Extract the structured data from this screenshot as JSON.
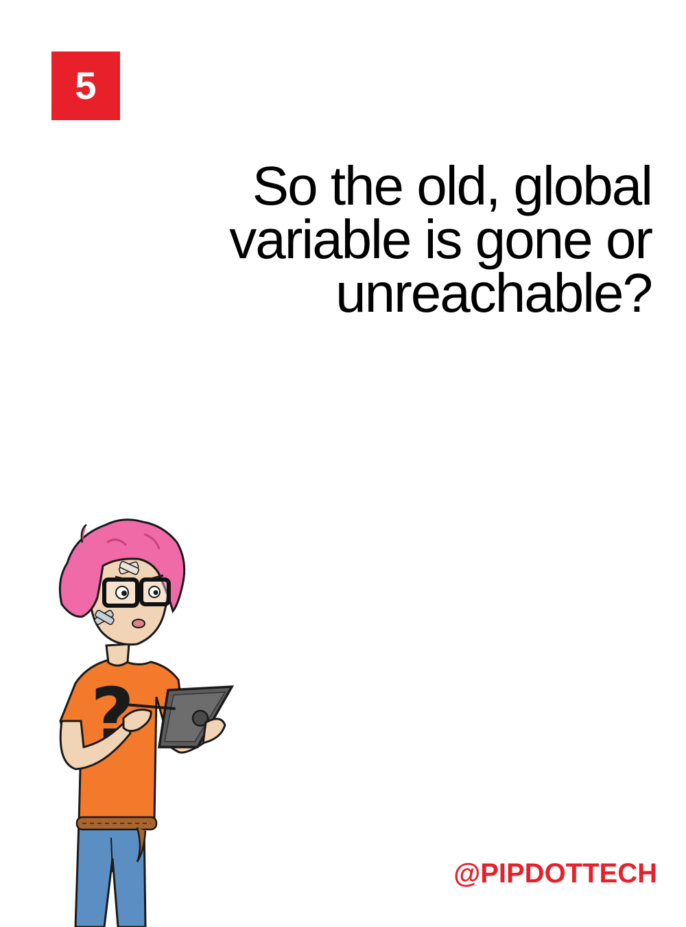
{
  "badge": {
    "number": "5",
    "color": "#e8202a"
  },
  "question": {
    "lines": [
      "So the old, global",
      "variable is gone or",
      "unreachable?"
    ]
  },
  "footer": {
    "handle": "@PIPDOTTECH"
  },
  "illustration": {
    "subject": "pink-haired character with glasses holding a tablet",
    "colors": {
      "hair": "#f06aa8",
      "shirt": "#f37a2a",
      "jeans": "#5b8fc4",
      "tablet": "#5d5d5d"
    }
  }
}
